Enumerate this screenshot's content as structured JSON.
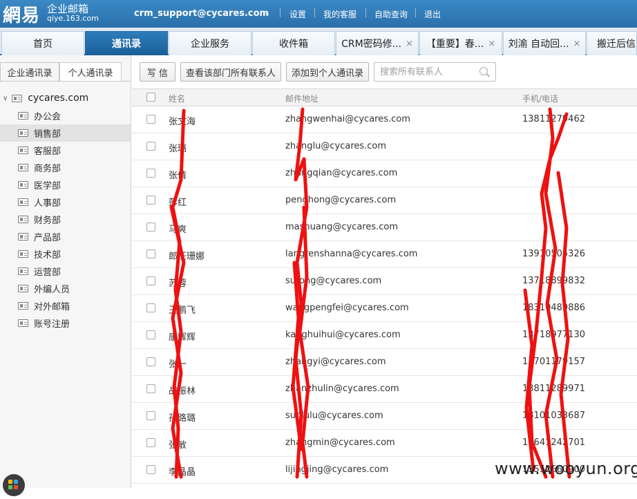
{
  "header": {
    "logo_main": "網易",
    "logo_title": "企业邮箱",
    "logo_domain": "qiye.163.com",
    "account": "crm_support@cycares.com",
    "links": [
      "设置",
      "我的客服",
      "自助查询",
      "退出"
    ]
  },
  "tabs": [
    {
      "label": "首页",
      "closable": false,
      "active": false
    },
    {
      "label": "通讯录",
      "closable": false,
      "active": true
    },
    {
      "label": "企业服务",
      "closable": false,
      "active": false
    },
    {
      "label": "收件箱",
      "closable": false,
      "active": false
    },
    {
      "label": "CRM密码修...",
      "closable": true,
      "active": false
    },
    {
      "label": "【重要】春...",
      "closable": true,
      "active": false
    },
    {
      "label": "刘渝 自动回...",
      "closable": true,
      "active": false
    },
    {
      "label": "搬迁后信息",
      "closable": false,
      "active": false
    }
  ],
  "tab_close_glyph": "×",
  "sidebar": {
    "tab_enterprise": "企业通讯录",
    "tab_personal": "个人通讯录",
    "root": "cycares.com",
    "selected_index": 1,
    "items": [
      "办公会",
      "销售部",
      "客服部",
      "商务部",
      "医学部",
      "人事部",
      "财务部",
      "产品部",
      "技术部",
      "运营部",
      "外编人员",
      "对外邮箱",
      "账号注册"
    ]
  },
  "toolbar": {
    "compose": "写 信",
    "view_all": "查看该部门所有联系人",
    "add_personal": "添加到个人通讯录",
    "search_placeholder": "搜索所有联系人"
  },
  "table": {
    "columns": [
      "姓名",
      "邮件地址",
      "手机/电话"
    ],
    "rows": [
      {
        "name": "张文海",
        "email": "zhangwenhai@cycares.com",
        "phone": "13811279462"
      },
      {
        "name": "张璐",
        "email": "zhanglu@cycares.com",
        "phone": ""
      },
      {
        "name": "张倩",
        "email": "zhangqian@cycares.com",
        "phone": ""
      },
      {
        "name": "彭红",
        "email": "penghong@cycares.com",
        "phone": ""
      },
      {
        "name": "马爽",
        "email": "mashuang@cycares.com",
        "phone": ""
      },
      {
        "name": "郎任珊娜",
        "email": "langrenshanna@cycares.com",
        "phone": "13910505326"
      },
      {
        "name": "苏蓉",
        "email": "surong@cycares.com",
        "phone": "13718899832"
      },
      {
        "name": "王鹏飞",
        "email": "wangpengfei@cycares.com",
        "phone": "18310489886"
      },
      {
        "name": "康辉辉",
        "email": "kanghuihui@cycares.com",
        "phone": "13718977130"
      },
      {
        "name": "张一",
        "email": "zhangyi@cycares.com",
        "phone": "13701179157"
      },
      {
        "name": "战振林",
        "email": "zhanzhulin@cycares.com",
        "phone": "13811289971"
      },
      {
        "name": "孙路璐",
        "email": "sunlulu@cycares.com",
        "phone": "18101033687"
      },
      {
        "name": "张敏",
        "email": "zhangmin@cycares.com",
        "phone": "13641242701"
      },
      {
        "name": "李晶晶",
        "email": "lijingjing@cycares.com",
        "phone": "13552660900"
      }
    ]
  },
  "watermark": "www.wooyun.org",
  "colors": {
    "header_bg": "#2a70ab",
    "active_tab": "#1b5f98",
    "scribble": "#ee1111"
  }
}
